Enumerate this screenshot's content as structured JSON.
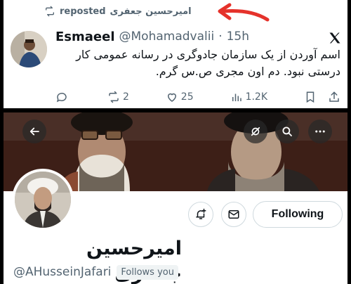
{
  "repost": {
    "name": "امیرحسین جعفری",
    "label": "reposted"
  },
  "tweet": {
    "author_name": "Esmaeel",
    "handle": "@Mohamadvalii",
    "separator": "·",
    "time": "15h",
    "text": "اسم آوردن از یک سازمان جادوگری در رسانه عمومی کار درستی نبود. دم اون مجری ص.س گرم.",
    "replies": "",
    "reposts": "2",
    "likes": "25",
    "views": "1.2K"
  },
  "profile": {
    "display_name": "امیرحسین جعفری",
    "handle": "@AHusseinJafari",
    "follows_badge": "Follows you",
    "following_label": "Following"
  },
  "colors": {
    "secondary_text": "#536471",
    "annotation_arrow": "#e5322b",
    "border": "#cfd9de"
  },
  "icons": [
    "repost-icon",
    "x-logo-icon",
    "reply-icon",
    "like-icon",
    "views-icon",
    "bookmark-icon",
    "share-icon",
    "back-arrow-icon",
    "hide-icon",
    "search-icon",
    "more-icon",
    "notify-icon",
    "mail-icon"
  ]
}
